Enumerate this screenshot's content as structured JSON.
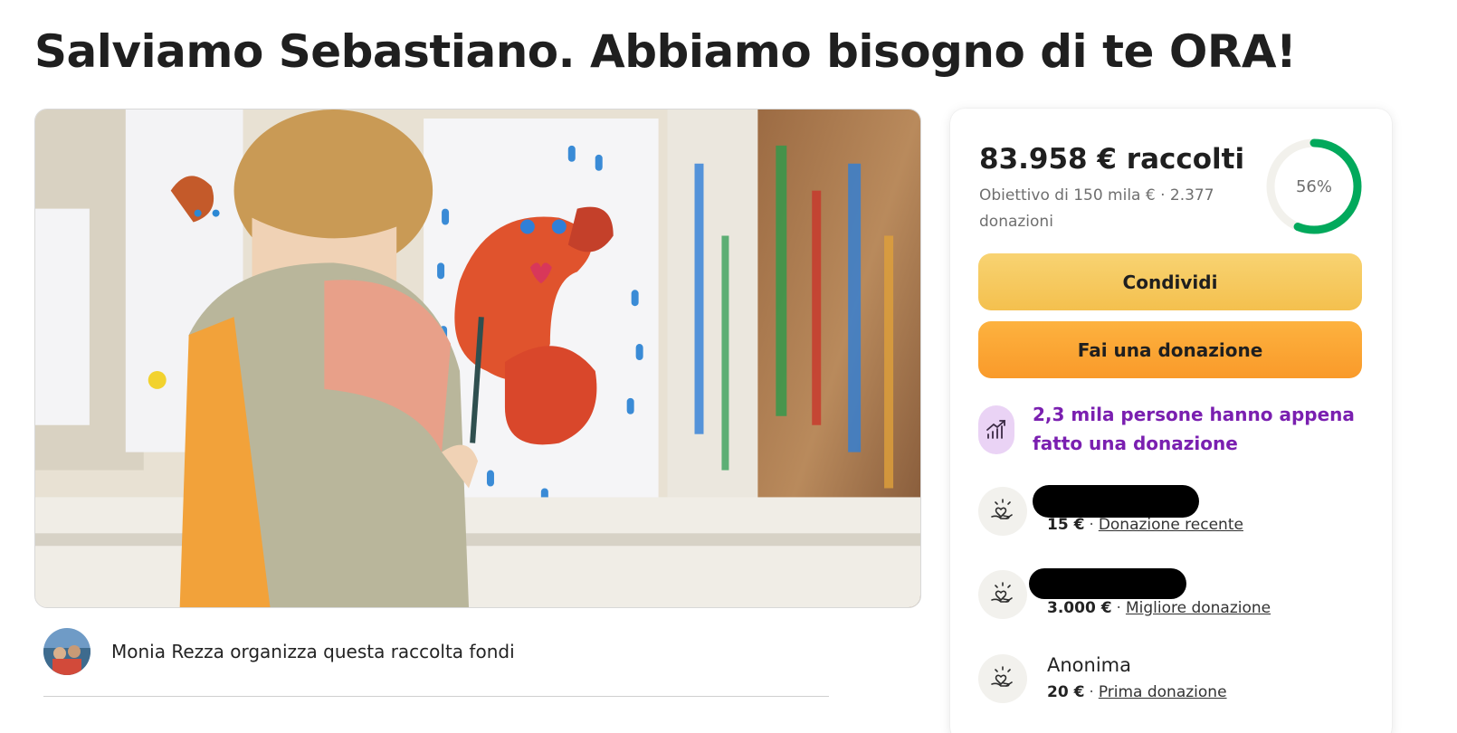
{
  "page": {
    "title": "Salviamo Sebastiano. Abbiamo bisogno di te ORA!"
  },
  "organizer": {
    "text": "Monia Rezza organizza questa raccolta fondi"
  },
  "progress": {
    "raised": "83.958 € raccolti",
    "goal_text": "Obiettivo di 150 mila €  ·  2.377 donazioni",
    "percent_label": "56%",
    "percent": 0.56,
    "ring_color": "#02a95c"
  },
  "actions": {
    "share_label": "Condividi",
    "donate_label": "Fai una donazione"
  },
  "trend": {
    "text": "2,3 mila persone hanno appena fatto una donazione",
    "icon": "trending-up-icon",
    "color": "#7a1fb0"
  },
  "donations": [
    {
      "name": "",
      "amount": "15 €",
      "label": "Donazione recente",
      "icon": "heart-hand-icon",
      "redacted": true
    },
    {
      "name": "",
      "amount": "3.000 €",
      "label": "Migliore donazione",
      "icon": "heart-hand-icon",
      "redacted": true
    },
    {
      "name": "Anonima",
      "amount": "20 €",
      "label": "Prima donazione",
      "icon": "heart-hand-icon",
      "redacted": false
    }
  ]
}
